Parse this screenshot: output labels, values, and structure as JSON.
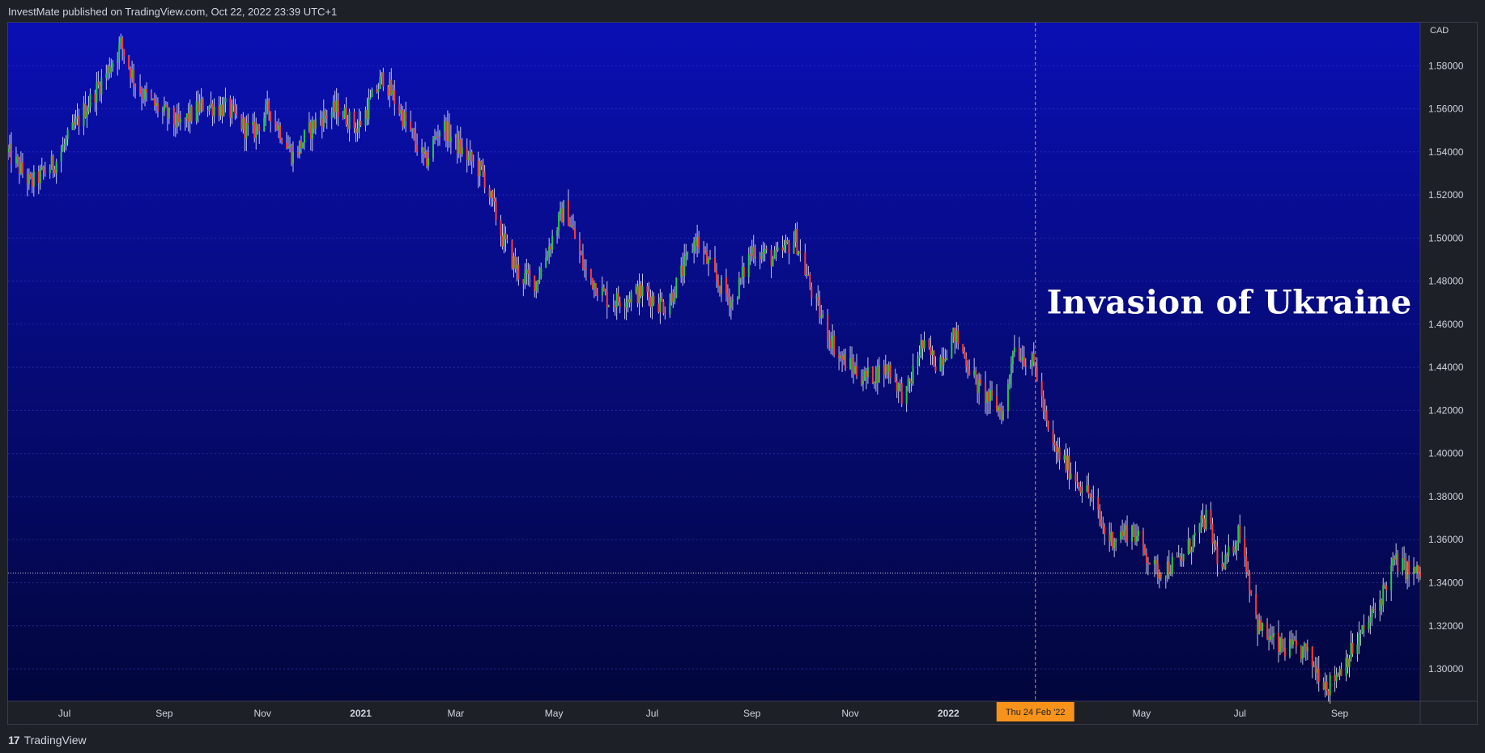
{
  "header": {
    "attribution": "InvestMate published on TradingView.com, Oct 22, 2022 23:39 UTC+1"
  },
  "footer": {
    "logo_glyph": "17",
    "brand": "TradingView"
  },
  "colors": {
    "bg_top": "#0a0fb4",
    "bg_bottom": "#02063c",
    "up": "#27c93f",
    "down": "#ff3b30",
    "wick": "#e8e8f5",
    "marker": "#f7931a",
    "grid": "#3b44c9"
  },
  "chart_data": {
    "type": "candlestick",
    "title": "",
    "currency_label": "CAD",
    "ylim": [
      1.285,
      1.6
    ],
    "y_ticks": [
      "1.58000",
      "1.56000",
      "1.54000",
      "1.52000",
      "1.50000",
      "1.48000",
      "1.46000",
      "1.44000",
      "1.42000",
      "1.40000",
      "1.38000",
      "1.36000",
      "1.34000",
      "1.32000",
      "1.30000"
    ],
    "y_tick_values": [
      1.58,
      1.56,
      1.54,
      1.52,
      1.5,
      1.48,
      1.46,
      1.44,
      1.42,
      1.4,
      1.38,
      1.36,
      1.34,
      1.32,
      1.3
    ],
    "x_range": [
      "2020-05-27",
      "2022-10-21"
    ],
    "x_ticks": [
      {
        "label": "Jul",
        "date": "2020-07-01",
        "bold": false
      },
      {
        "label": "Sep",
        "date": "2020-09-01",
        "bold": false
      },
      {
        "label": "Nov",
        "date": "2020-11-01",
        "bold": false
      },
      {
        "label": "2021",
        "date": "2021-01-01",
        "bold": true
      },
      {
        "label": "Mar",
        "date": "2021-03-01",
        "bold": false
      },
      {
        "label": "May",
        "date": "2021-05-01",
        "bold": false
      },
      {
        "label": "Jul",
        "date": "2021-07-01",
        "bold": false
      },
      {
        "label": "Sep",
        "date": "2021-09-01",
        "bold": false
      },
      {
        "label": "Nov",
        "date": "2021-11-01",
        "bold": false
      },
      {
        "label": "2022",
        "date": "2022-01-01",
        "bold": true
      },
      {
        "label": "May",
        "date": "2022-05-01",
        "bold": false
      },
      {
        "label": "Jul",
        "date": "2022-07-01",
        "bold": false
      },
      {
        "label": "Sep",
        "date": "2022-09-01",
        "bold": false
      }
    ],
    "price_path": [
      [
        "2020-05-27",
        1.54
      ],
      [
        "2020-06-10",
        1.525
      ],
      [
        "2020-06-25",
        1.535
      ],
      [
        "2020-07-10",
        1.555
      ],
      [
        "2020-07-28",
        1.578
      ],
      [
        "2020-08-05",
        1.59
      ],
      [
        "2020-08-15",
        1.57
      ],
      [
        "2020-08-25",
        1.562
      ],
      [
        "2020-09-10",
        1.552
      ],
      [
        "2020-09-25",
        1.562
      ],
      [
        "2020-10-10",
        1.56
      ],
      [
        "2020-10-25",
        1.548
      ],
      [
        "2020-11-05",
        1.56
      ],
      [
        "2020-11-20",
        1.538
      ],
      [
        "2020-12-05",
        1.555
      ],
      [
        "2020-12-18",
        1.56
      ],
      [
        "2020-12-30",
        1.551
      ],
      [
        "2021-01-15",
        1.575
      ],
      [
        "2021-01-28",
        1.555
      ],
      [
        "2021-02-10",
        1.535
      ],
      [
        "2021-02-20",
        1.553
      ],
      [
        "2021-03-05",
        1.54
      ],
      [
        "2021-03-18",
        1.53
      ],
      [
        "2021-03-30",
        1.5
      ],
      [
        "2021-04-10",
        1.482
      ],
      [
        "2021-04-20",
        1.48
      ],
      [
        "2021-04-30",
        1.5
      ],
      [
        "2021-05-08",
        1.515
      ],
      [
        "2021-05-20",
        1.485
      ],
      [
        "2021-06-05",
        1.47
      ],
      [
        "2021-06-25",
        1.475
      ],
      [
        "2021-07-10",
        1.468
      ],
      [
        "2021-07-20",
        1.485
      ],
      [
        "2021-07-28",
        1.5
      ],
      [
        "2021-08-10",
        1.48
      ],
      [
        "2021-08-20",
        1.47
      ],
      [
        "2021-09-01",
        1.495
      ],
      [
        "2021-09-15",
        1.49
      ],
      [
        "2021-09-28",
        1.5
      ],
      [
        "2021-10-10",
        1.47
      ],
      [
        "2021-10-25",
        1.445
      ],
      [
        "2021-11-10",
        1.435
      ],
      [
        "2021-11-25",
        1.44
      ],
      [
        "2021-12-05",
        1.425
      ],
      [
        "2021-12-15",
        1.45
      ],
      [
        "2021-12-25",
        1.442
      ],
      [
        "2022-01-05",
        1.455
      ],
      [
        "2022-01-20",
        1.43
      ],
      [
        "2022-02-05",
        1.418
      ],
      [
        "2022-02-10",
        1.45
      ],
      [
        "2022-02-24",
        1.44
      ],
      [
        "2022-03-05",
        1.405
      ],
      [
        "2022-03-15",
        1.395
      ],
      [
        "2022-03-30",
        1.38
      ],
      [
        "2022-04-10",
        1.36
      ],
      [
        "2022-04-25",
        1.365
      ],
      [
        "2022-05-10",
        1.345
      ],
      [
        "2022-05-25",
        1.35
      ],
      [
        "2022-06-10",
        1.37
      ],
      [
        "2022-06-20",
        1.345
      ],
      [
        "2022-07-01",
        1.365
      ],
      [
        "2022-07-12",
        1.32
      ],
      [
        "2022-07-25",
        1.31
      ],
      [
        "2022-08-10",
        1.308
      ],
      [
        "2022-08-25",
        1.292
      ],
      [
        "2022-09-10",
        1.31
      ],
      [
        "2022-09-25",
        1.33
      ],
      [
        "2022-10-05",
        1.35
      ],
      [
        "2022-10-15",
        1.345
      ],
      [
        "2022-10-21",
        1.344
      ]
    ],
    "current_price": 1.3445,
    "annotations": [
      {
        "date": "2022-02-24",
        "label": "Thu 24 Feb '22",
        "text": "Invasion of Ukraine"
      }
    ]
  }
}
